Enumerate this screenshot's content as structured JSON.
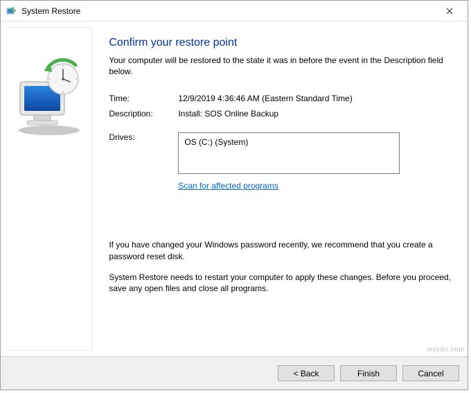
{
  "window": {
    "title": "System Restore"
  },
  "page": {
    "heading": "Confirm your restore point",
    "intro": "Your computer will be restored to the state it was in before the event in the Description field below."
  },
  "fields": {
    "time_label": "Time:",
    "time_value": "12/9/2019 4:36:46 AM (Eastern Standard Time)",
    "description_label": "Description:",
    "description_value": "Install: SOS Online Backup",
    "drives_label": "Drives:",
    "drives_value": "OS (C:) (System)"
  },
  "links": {
    "scan": "Scan for affected programs"
  },
  "notes": {
    "password": "If you have changed your Windows password recently, we recommend that you create a password reset disk.",
    "restart": "System Restore needs to restart your computer to apply these changes. Before you proceed, save any open files and close all programs."
  },
  "buttons": {
    "back": "< Back",
    "finish": "Finish",
    "cancel": "Cancel"
  },
  "watermark": "wsxdn.com"
}
